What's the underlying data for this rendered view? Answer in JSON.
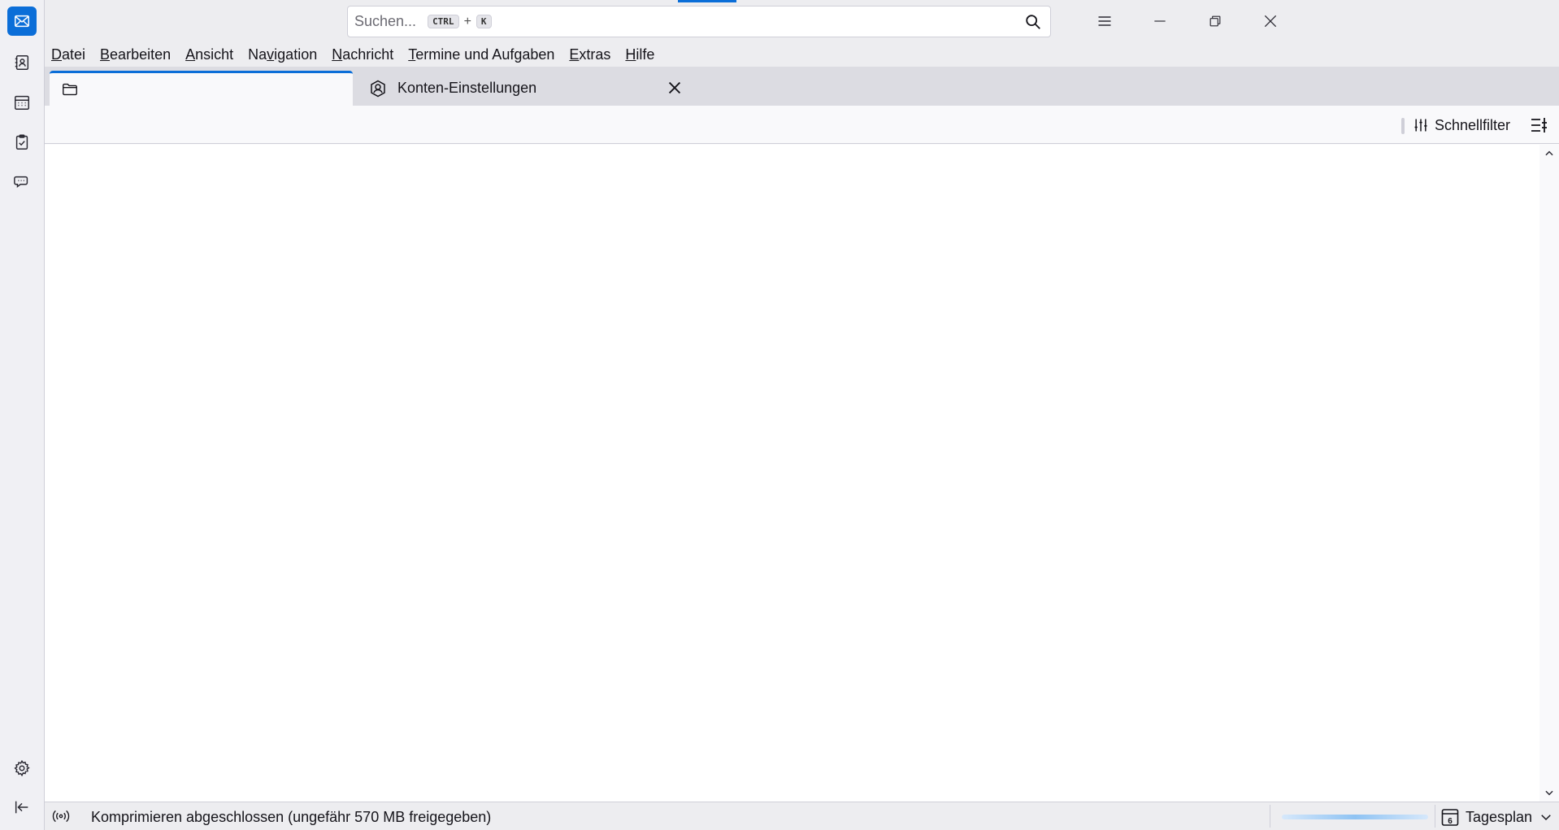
{
  "spaces": {
    "items": [
      {
        "name": "mail",
        "icon": "mail-icon",
        "active": true
      },
      {
        "name": "address-book",
        "icon": "address-book-icon"
      },
      {
        "name": "calendar",
        "icon": "calendar-icon"
      },
      {
        "name": "tasks",
        "icon": "tasks-icon"
      },
      {
        "name": "chat",
        "icon": "chat-icon"
      }
    ],
    "bottom": [
      {
        "name": "settings",
        "icon": "gear-icon"
      },
      {
        "name": "collapse",
        "icon": "collapse-icon"
      }
    ]
  },
  "search": {
    "placeholder": "Suchen...",
    "shortcut_mod": "CTRL",
    "shortcut_plus": "+",
    "shortcut_key": "K"
  },
  "menu": {
    "items": [
      {
        "underline": "D",
        "rest": "atei"
      },
      {
        "underline": "B",
        "rest": "earbeiten"
      },
      {
        "underline": "A",
        "rest": "nsicht"
      },
      {
        "pre": "Na",
        "underline": "v",
        "rest": "igation"
      },
      {
        "underline": "N",
        "rest": "achricht"
      },
      {
        "underline": "T",
        "rest": "ermine und Aufgaben"
      },
      {
        "underline": "E",
        "rest": "xtras"
      },
      {
        "underline": "H",
        "rest": "ilfe"
      }
    ]
  },
  "tabs": [
    {
      "label": "",
      "icon": "folder-icon",
      "active": true
    },
    {
      "label": "Konten-Einstellungen",
      "icon": "account-settings-icon",
      "closable": true
    }
  ],
  "filterbar": {
    "quick_filter_label": "Schnellfilter"
  },
  "status": {
    "message": "Komprimieren abgeschlossen (ungefähr 570 MB freigegeben)",
    "today_pane_label": "Tagesplan",
    "calendar_day": "6"
  },
  "colors": {
    "accent": "#0b6ed8",
    "chrome": "#ededf0",
    "tabbar": "#dcdce2"
  }
}
